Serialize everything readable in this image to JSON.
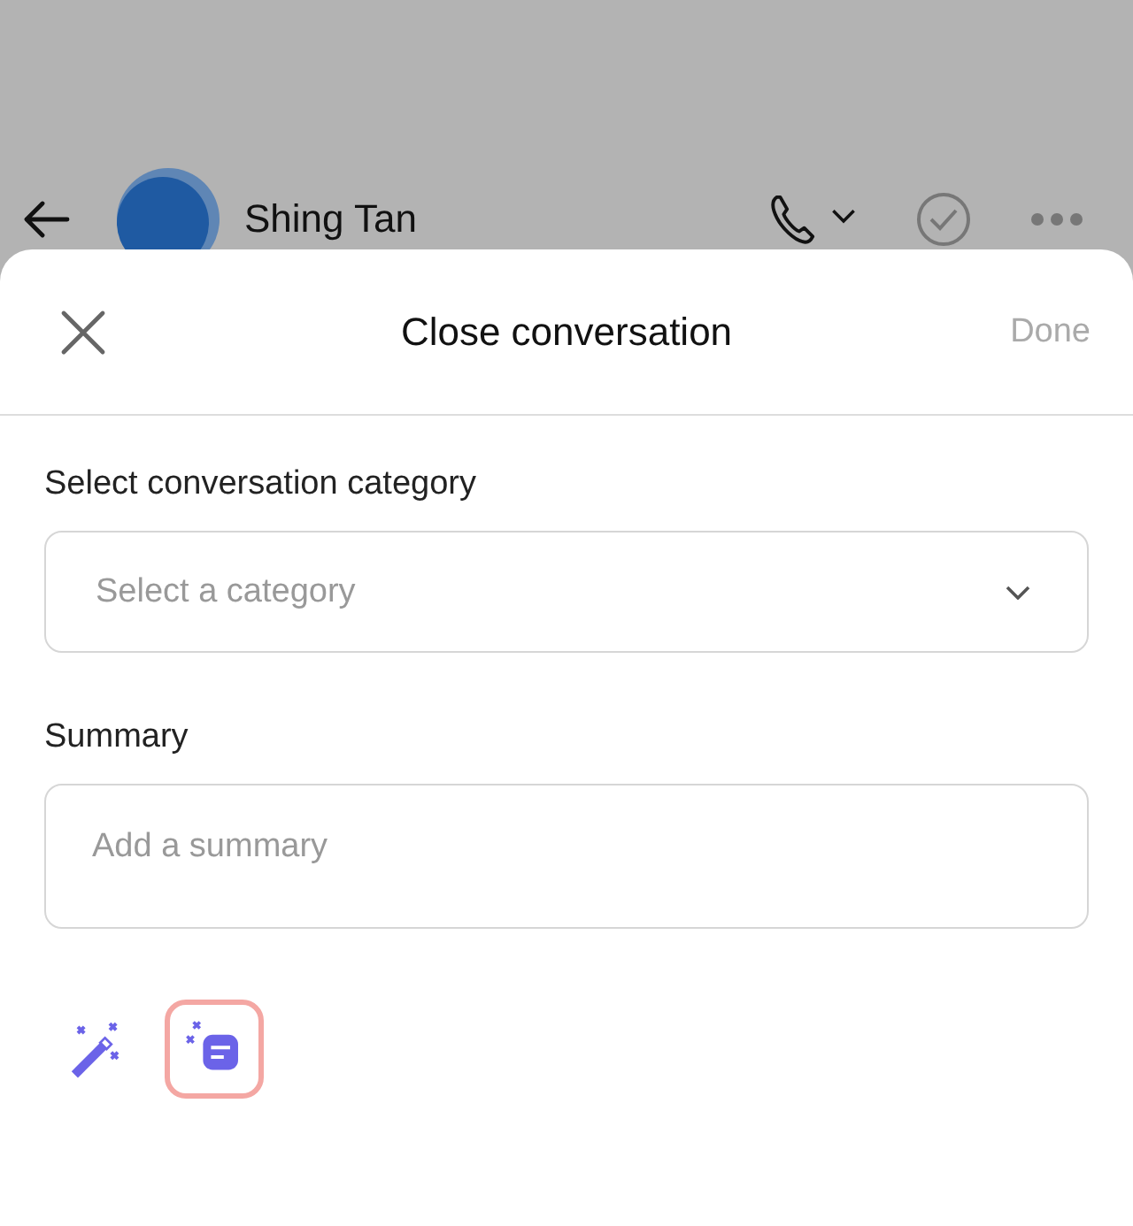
{
  "chat_header": {
    "contact_name": "Shing Tan"
  },
  "sheet": {
    "title": "Close conversation",
    "done_label": "Done",
    "done_disabled": true
  },
  "category": {
    "label": "Select conversation category",
    "placeholder": "Select a category"
  },
  "summary": {
    "label": "Summary",
    "placeholder": "Add a summary"
  },
  "ai_tools": [
    {
      "kind": "wand",
      "selected": false
    },
    {
      "kind": "summarize",
      "selected": true
    }
  ]
}
